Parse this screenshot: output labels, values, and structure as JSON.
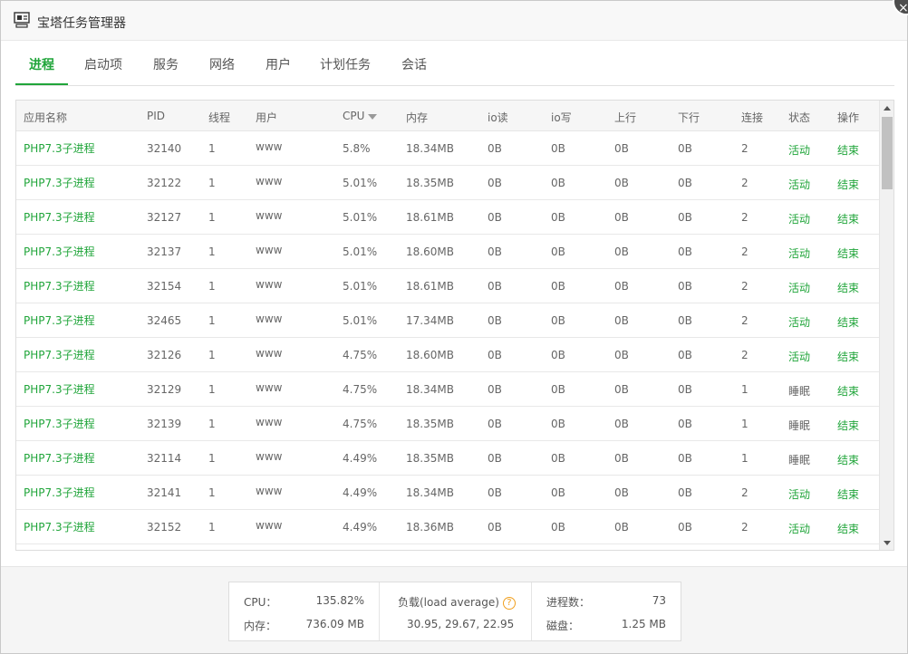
{
  "window": {
    "title": "宝塔任务管理器",
    "close_label": "×"
  },
  "tabs": [
    {
      "label": "进程",
      "active": true
    },
    {
      "label": "启动项",
      "active": false
    },
    {
      "label": "服务",
      "active": false
    },
    {
      "label": "网络",
      "active": false
    },
    {
      "label": "用户",
      "active": false
    },
    {
      "label": "计划任务",
      "active": false
    },
    {
      "label": "会话",
      "active": false
    }
  ],
  "table": {
    "columns": [
      "应用名称",
      "PID",
      "线程",
      "用户",
      "CPU",
      "内存",
      "io读",
      "io写",
      "上行",
      "下行",
      "连接",
      "状态",
      "操作"
    ],
    "sort_column": "CPU",
    "rows": [
      {
        "name": "PHP7.3子进程",
        "pid": "32140",
        "threads": "1",
        "user": "www",
        "cpu": "5.8%",
        "mem": "18.34MB",
        "io_read": "0B",
        "io_write": "0B",
        "up": "0B",
        "down": "0B",
        "conn": "2",
        "status": "活动",
        "action": "结束"
      },
      {
        "name": "PHP7.3子进程",
        "pid": "32122",
        "threads": "1",
        "user": "www",
        "cpu": "5.01%",
        "mem": "18.35MB",
        "io_read": "0B",
        "io_write": "0B",
        "up": "0B",
        "down": "0B",
        "conn": "2",
        "status": "活动",
        "action": "结束"
      },
      {
        "name": "PHP7.3子进程",
        "pid": "32127",
        "threads": "1",
        "user": "www",
        "cpu": "5.01%",
        "mem": "18.61MB",
        "io_read": "0B",
        "io_write": "0B",
        "up": "0B",
        "down": "0B",
        "conn": "2",
        "status": "活动",
        "action": "结束"
      },
      {
        "name": "PHP7.3子进程",
        "pid": "32137",
        "threads": "1",
        "user": "www",
        "cpu": "5.01%",
        "mem": "18.60MB",
        "io_read": "0B",
        "io_write": "0B",
        "up": "0B",
        "down": "0B",
        "conn": "2",
        "status": "活动",
        "action": "结束"
      },
      {
        "name": "PHP7.3子进程",
        "pid": "32154",
        "threads": "1",
        "user": "www",
        "cpu": "5.01%",
        "mem": "18.61MB",
        "io_read": "0B",
        "io_write": "0B",
        "up": "0B",
        "down": "0B",
        "conn": "2",
        "status": "活动",
        "action": "结束"
      },
      {
        "name": "PHP7.3子进程",
        "pid": "32465",
        "threads": "1",
        "user": "www",
        "cpu": "5.01%",
        "mem": "17.34MB",
        "io_read": "0B",
        "io_write": "0B",
        "up": "0B",
        "down": "0B",
        "conn": "2",
        "status": "活动",
        "action": "结束"
      },
      {
        "name": "PHP7.3子进程",
        "pid": "32126",
        "threads": "1",
        "user": "www",
        "cpu": "4.75%",
        "mem": "18.60MB",
        "io_read": "0B",
        "io_write": "0B",
        "up": "0B",
        "down": "0B",
        "conn": "2",
        "status": "活动",
        "action": "结束"
      },
      {
        "name": "PHP7.3子进程",
        "pid": "32129",
        "threads": "1",
        "user": "www",
        "cpu": "4.75%",
        "mem": "18.34MB",
        "io_read": "0B",
        "io_write": "0B",
        "up": "0B",
        "down": "0B",
        "conn": "1",
        "status": "睡眠",
        "action": "结束"
      },
      {
        "name": "PHP7.3子进程",
        "pid": "32139",
        "threads": "1",
        "user": "www",
        "cpu": "4.75%",
        "mem": "18.35MB",
        "io_read": "0B",
        "io_write": "0B",
        "up": "0B",
        "down": "0B",
        "conn": "1",
        "status": "睡眠",
        "action": "结束"
      },
      {
        "name": "PHP7.3子进程",
        "pid": "32114",
        "threads": "1",
        "user": "www",
        "cpu": "4.49%",
        "mem": "18.35MB",
        "io_read": "0B",
        "io_write": "0B",
        "up": "0B",
        "down": "0B",
        "conn": "1",
        "status": "睡眠",
        "action": "结束"
      },
      {
        "name": "PHP7.3子进程",
        "pid": "32141",
        "threads": "1",
        "user": "www",
        "cpu": "4.49%",
        "mem": "18.34MB",
        "io_read": "0B",
        "io_write": "0B",
        "up": "0B",
        "down": "0B",
        "conn": "2",
        "status": "活动",
        "action": "结束"
      },
      {
        "name": "PHP7.3子进程",
        "pid": "32152",
        "threads": "1",
        "user": "www",
        "cpu": "4.49%",
        "mem": "18.36MB",
        "io_read": "0B",
        "io_write": "0B",
        "up": "0B",
        "down": "0B",
        "conn": "2",
        "status": "活动",
        "action": "结束"
      }
    ]
  },
  "summary": {
    "cpu_label": "CPU：",
    "cpu_value": "135.82%",
    "mem_label": "内存：",
    "mem_value": "736.09 MB",
    "load_label": "负载(load average)",
    "load_value": "30.95, 29.67, 22.95",
    "proc_label": "进程数：",
    "proc_value": "73",
    "disk_label": "磁盘：",
    "disk_value": "1.25 MB",
    "help_glyph": "?"
  },
  "colors": {
    "accent": "#20a53a",
    "help": "#f0a020"
  }
}
